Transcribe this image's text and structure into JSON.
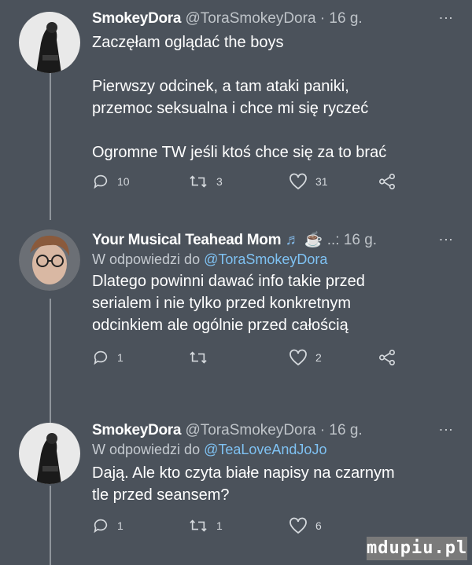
{
  "tweets": [
    {
      "name": "SmokeyDora",
      "handle": "@ToraSmokeyDora",
      "time": "· 16 g.",
      "reply_prefix": "",
      "reply_mention": "",
      "lines": [
        "Zaczęłam oglądać the boys",
        "",
        "Pierwszy odcinek, a tam ataki paniki,",
        "przemoc seksualna i chce mi się ryczeć",
        "",
        "Ogromne TW jeśli ktoś chce się za to brać"
      ],
      "replies": "10",
      "retweets": "3",
      "likes": "31"
    },
    {
      "name": "Your Musical Teahead Mom",
      "name_emoji": "♬ ☕",
      "handle": "..:",
      "time": "16 g.",
      "reply_prefix": "W odpowiedzi do ",
      "reply_mention": "@ToraSmokeyDora",
      "lines": [
        "Dlatego powinni dawać info takie przed",
        "serialem i nie tylko przed konkretnym",
        "odcinkiem ale ogólnie przed całością"
      ],
      "replies": "1",
      "retweets": "",
      "likes": "2"
    },
    {
      "name": "SmokeyDora",
      "handle": "@ToraSmokeyDora",
      "time": "· 16 g.",
      "reply_prefix": "W odpowiedzi do ",
      "reply_mention": "@TeaLoveAndJoJo",
      "lines": [
        "Dają. Ale kto czyta białe napisy na czarnym",
        "tle przed seansem?"
      ],
      "replies": "1",
      "retweets": "1",
      "likes": "6"
    }
  ],
  "watermark": "mdupiu.pl",
  "icons": [
    "reply-icon",
    "retweet-icon",
    "like-icon",
    "share-icon",
    "more-icon"
  ],
  "colors": {
    "background": "#4b525b",
    "mention": "#7fc2f3",
    "handle": "#bfc4c9"
  }
}
